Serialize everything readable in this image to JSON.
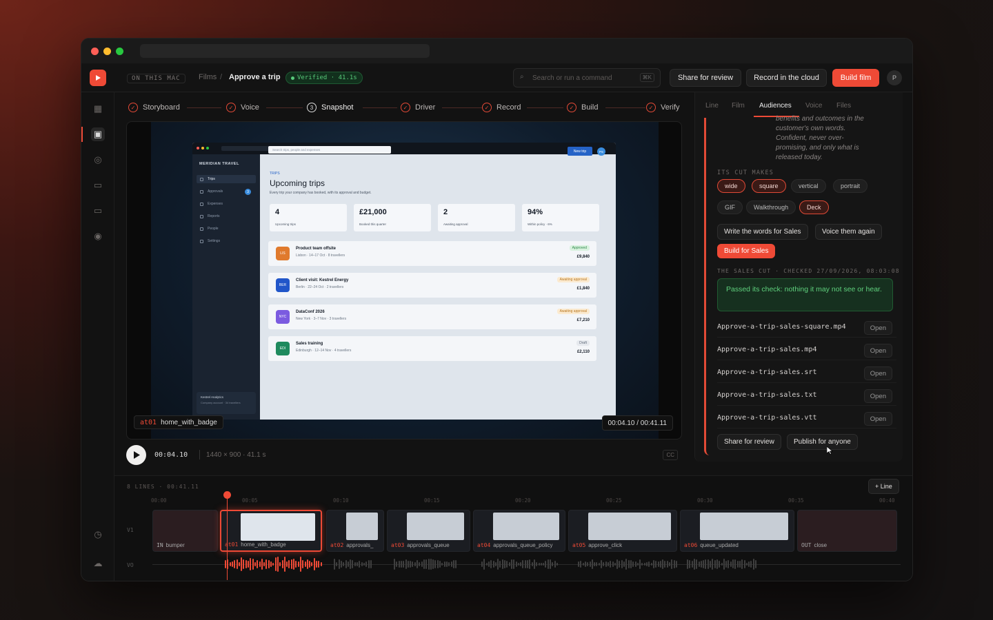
{
  "window": {
    "url": ""
  },
  "topbar": {
    "location_chip": "ON THIS MAC",
    "breadcrumb_root": "Films",
    "breadcrumb_sep": "/",
    "breadcrumb_current": "Approve a trip",
    "status_badge": "Verified · 41.1s",
    "search_placeholder": "Search or run a command",
    "search_shortcut": "⌘K",
    "share_label": "Share for review",
    "record_label": "Record in the cloud",
    "build_label": "Build film",
    "avatar_initial": "P"
  },
  "steps": [
    {
      "label": "Storyboard",
      "state": "done"
    },
    {
      "label": "Voice",
      "state": "done"
    },
    {
      "label": "Snapshot",
      "state": "current",
      "number": "3"
    },
    {
      "label": "Driver",
      "state": "done"
    },
    {
      "label": "Record",
      "state": "done"
    },
    {
      "label": "Build",
      "state": "done"
    },
    {
      "label": "Verify",
      "state": "done"
    }
  ],
  "preview": {
    "brand": "MERIDIAN TRAVEL",
    "search": "Search trips, people and expenses",
    "new_trip": "New trip",
    "user": "PS",
    "nav": [
      "Trips",
      "Approvals",
      "Expenses",
      "Reports",
      "People",
      "Settings"
    ],
    "approvals_count": "3",
    "footer_company": "Kestrel Analytics",
    "footer_sub": "Company account · 34 travellers",
    "section": "TRIPS",
    "title": "Upcoming trips",
    "subtitle": "Every trip your company has booked, with its approval and budget.",
    "stats": [
      {
        "value": "4",
        "label": "Upcoming trips"
      },
      {
        "value": "£21,000",
        "label": "Booked this quarter"
      },
      {
        "value": "2",
        "label": "Awaiting approval"
      },
      {
        "value": "94%",
        "label": "Within policy · 6%"
      }
    ],
    "trips": [
      {
        "code": "LIS",
        "name": "Product team offsite",
        "meta": "Lisbon · 14–17 Oct · 8 travellers",
        "badge": "Approved",
        "price": "£9,840",
        "color": "#e07a2d",
        "badge_bg": "#d9f2df",
        "badge_fg": "#2f8a4a"
      },
      {
        "code": "BER",
        "name": "Client visit: Kestrel Energy",
        "meta": "Berlin · 22–24 Oct · 2 travellers",
        "badge": "Awaiting approval",
        "price": "£1,840",
        "color": "#2156c9",
        "badge_bg": "#fbead0",
        "badge_fg": "#b8761e"
      },
      {
        "code": "NYC",
        "name": "DataConf 2026",
        "meta": "New York · 3–7 Nov · 3 travellers",
        "badge": "Awaiting approval",
        "price": "£7,210",
        "color": "#7b5be0",
        "badge_bg": "#fbead0",
        "badge_fg": "#b8761e"
      },
      {
        "code": "EDI",
        "name": "Sales training",
        "meta": "Edinburgh · 12–14 Nov · 4 travellers",
        "badge": "Draft",
        "price": "£2,110",
        "color": "#1f8a5e",
        "badge_bg": "#e6e9ee",
        "badge_fg": "#5f6b7a"
      }
    ],
    "caption_id": "at01",
    "caption_name": "home_with_badge",
    "timecode": "00:04.10 / 00:41.11"
  },
  "controls": {
    "time": "00:04.10",
    "meta": "1440 × 900 · 41.1 s",
    "cc": "CC"
  },
  "right_panel": {
    "tabs": [
      "Line",
      "Film",
      "Audiences",
      "Voice",
      "Files"
    ],
    "active_tab": "Audiences",
    "intro_lines": [
      "benefits and outcomes in the",
      "customer's own words.",
      "Confident, never over-",
      "promising, and only what is",
      "released today."
    ],
    "cut_label": "ITS CUT MAKES",
    "formats_row1": [
      {
        "label": "wide",
        "on": true
      },
      {
        "label": "square",
        "on": true
      },
      {
        "label": "vertical",
        "on": false
      },
      {
        "label": "portrait",
        "on": false
      }
    ],
    "formats_row2": [
      {
        "label": "GIF",
        "on": false
      },
      {
        "label": "Walkthrough",
        "on": false
      },
      {
        "label": "Deck",
        "on": true
      }
    ],
    "write_words": "Write the words for Sales",
    "voice_again": "Voice them again",
    "build_sales": "Build for Sales",
    "checked_label": "THE SALES CUT · CHECKED 27/09/2026, 08:03:08",
    "check_result": "Passed its check: nothing it may not see or hear.",
    "files": [
      {
        "name": "Approve-a-trip-sales-square.mp4",
        "action": "Open"
      },
      {
        "name": "Approve-a-trip-sales.mp4",
        "action": "Open"
      },
      {
        "name": "Approve-a-trip-sales.srt",
        "action": "Open"
      },
      {
        "name": "Approve-a-trip-sales.txt",
        "action": "Open"
      },
      {
        "name": "Approve-a-trip-sales.vtt",
        "action": "Open"
      }
    ],
    "share_label": "Share for review",
    "publish_label": "Publish for anyone"
  },
  "timeline": {
    "summary": "8 LINES · 00:41.11",
    "add_line": "+ Line",
    "track_v1": "V1",
    "track_vo": "VO",
    "ticks": [
      "00:00",
      "00:05",
      "00:10",
      "00:15",
      "00:20",
      "00:25",
      "00:30",
      "00:35",
      "00:40"
    ],
    "clips": [
      {
        "id": "IN",
        "name": "bumper"
      },
      {
        "id": "at01",
        "name": "home_with_badge"
      },
      {
        "id": "at02",
        "name": "approvals_"
      },
      {
        "id": "at03",
        "name": "approvals_queue"
      },
      {
        "id": "at04",
        "name": "approvals_queue_policy"
      },
      {
        "id": "at05",
        "name": "approve_click"
      },
      {
        "id": "at06",
        "name": "queue_updated"
      },
      {
        "id": "OUT",
        "name": "close"
      }
    ],
    "accent": "#ef4a36"
  }
}
